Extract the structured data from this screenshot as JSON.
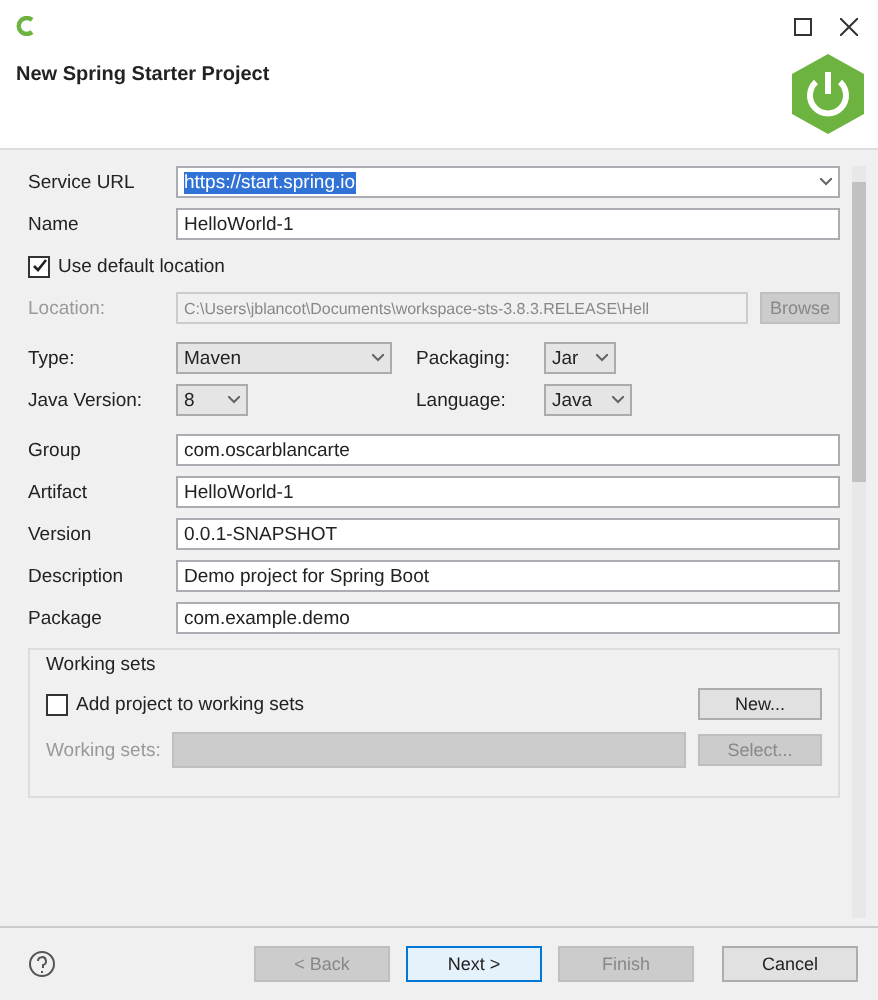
{
  "header": {
    "title": "New Spring Starter Project"
  },
  "service_url": {
    "label": "Service URL",
    "value": "https://start.spring.io",
    "selected": true
  },
  "name": {
    "label": "Name",
    "value": "HelloWorld-1"
  },
  "use_default_location": {
    "label": "Use default location",
    "checked": true
  },
  "location": {
    "label": "Location:",
    "value": "C:\\Users\\jblancot\\Documents\\workspace-sts-3.8.3.RELEASE\\Hell",
    "disabled": true,
    "button": {
      "label": "Browse",
      "disabled": true
    }
  },
  "options": [
    {
      "label": "Type:",
      "value": "Maven",
      "kind": "wide"
    },
    {
      "label": "Packaging:",
      "value": "Jar",
      "kind": "narrow"
    },
    {
      "label": "Java Version:",
      "value": "8",
      "kind": "narrow"
    },
    {
      "label": "Language:",
      "value": "Java",
      "kind": "medium"
    }
  ],
  "fields": [
    {
      "label": "Group",
      "value": "com.oscarblancarte"
    },
    {
      "label": "Artifact",
      "value": "HelloWorld-1"
    },
    {
      "label": "Version",
      "value": "0.0.1-SNAPSHOT"
    },
    {
      "label": "Description",
      "value": "Demo project for Spring Boot"
    },
    {
      "label": "Package",
      "value": "com.example.demo"
    }
  ],
  "working_sets": {
    "title": "Working sets",
    "checkbox": {
      "label": "Add project to working sets",
      "checked": false
    },
    "new_button": {
      "label": "New...",
      "disabled": false
    },
    "select_label": {
      "label": "Working sets:",
      "disabled": true
    },
    "select_button": {
      "label": "Select...",
      "disabled": true
    }
  },
  "buttons": [
    {
      "label": "< Back",
      "disabled": true,
      "default": false
    },
    {
      "label": "Next >",
      "disabled": false,
      "default": true
    },
    {
      "label": "Finish",
      "disabled": true,
      "default": false
    },
    {
      "label": "Cancel",
      "disabled": false,
      "default": false
    }
  ]
}
